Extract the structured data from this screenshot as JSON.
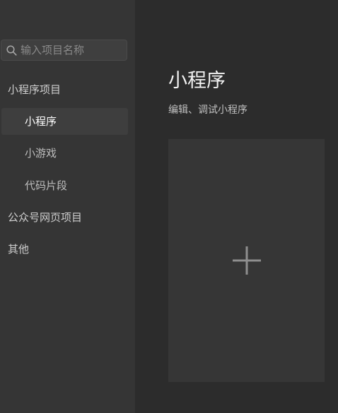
{
  "search": {
    "placeholder": "输入项目名称"
  },
  "sidebar": {
    "items": [
      {
        "label": "小程序项目"
      },
      {
        "label": "小程序"
      },
      {
        "label": "小游戏"
      },
      {
        "label": "代码片段"
      },
      {
        "label": "公众号网页项目"
      },
      {
        "label": "其他"
      }
    ]
  },
  "main": {
    "title": "小程序",
    "subtitle": "编辑、调试小程序"
  },
  "icons": {
    "search": "search-icon",
    "plus": "plus-icon"
  },
  "colors": {
    "background": "#2c2c2c",
    "sidebar": "#353535",
    "card": "#363636"
  }
}
